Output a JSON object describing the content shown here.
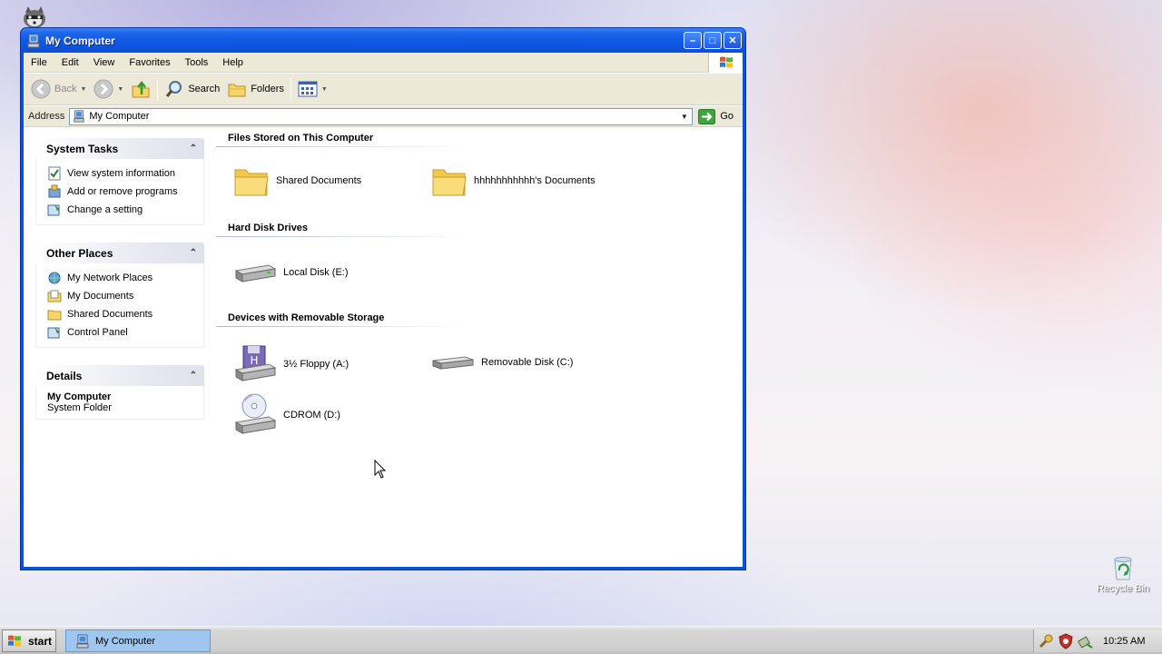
{
  "window": {
    "title": "My Computer"
  },
  "menu": [
    "File",
    "Edit",
    "View",
    "Favorites",
    "Tools",
    "Help"
  ],
  "toolbar": {
    "back": "Back",
    "search": "Search",
    "folders": "Folders"
  },
  "address": {
    "label": "Address",
    "value": "My Computer",
    "go": "Go"
  },
  "left_pane": {
    "system_tasks": {
      "title": "System Tasks",
      "items": [
        "View system information",
        "Add or remove programs",
        "Change a setting"
      ]
    },
    "other_places": {
      "title": "Other Places",
      "items": [
        "My Network Places",
        "My Documents",
        "Shared Documents",
        "Control Panel"
      ]
    },
    "details": {
      "title": "Details",
      "name": "My Computer",
      "type": "System Folder"
    }
  },
  "groups": {
    "files": {
      "title": "Files Stored on This Computer",
      "items": [
        "Shared Documents",
        "hhhhhhhhhhh's Documents"
      ]
    },
    "hdd": {
      "title": "Hard Disk Drives",
      "items": [
        "Local Disk (E:)"
      ]
    },
    "removable": {
      "title": "Devices with Removable Storage",
      "items": [
        "3½ Floppy (A:)",
        "Removable Disk (C:)",
        "CDROM (D:)"
      ]
    }
  },
  "desktop": {
    "recycle_bin": "Recycle Bin"
  },
  "taskbar": {
    "start": "start",
    "task": "My Computer",
    "clock": "10:25 AM"
  },
  "colors": {
    "title_blue": "#0f56e2",
    "task_selected": "#9fc6ef"
  }
}
